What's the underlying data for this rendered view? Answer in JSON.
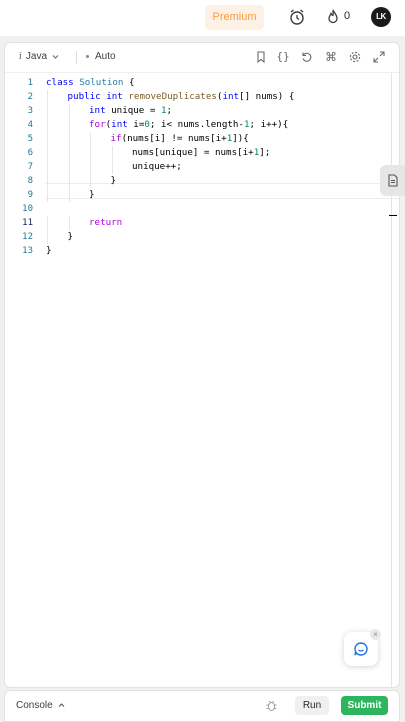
{
  "topbar": {
    "premium_label": "Premium",
    "streak_count": "0",
    "avatar_initials": "LK"
  },
  "toolbar": {
    "language": "Java",
    "language_icon": "i",
    "mode": "Auto"
  },
  "editor": {
    "active_line": 11,
    "lines": [
      {
        "n": "1",
        "tokens": [
          {
            "t": "class ",
            "c": "kw"
          },
          {
            "t": "Solution",
            "c": "ty"
          },
          {
            "t": " {",
            "c": "pl"
          }
        ],
        "indent": 0
      },
      {
        "n": "2",
        "tokens": [
          {
            "t": "public ",
            "c": "kw"
          },
          {
            "t": "int ",
            "c": "kw"
          },
          {
            "t": "removeDuplicates",
            "c": "fn"
          },
          {
            "t": "(",
            "c": "pl"
          },
          {
            "t": "int",
            "c": "kw"
          },
          {
            "t": "[] nums) ",
            "c": "pl"
          },
          {
            "t": "{",
            "c": "pl"
          }
        ],
        "indent": 1
      },
      {
        "n": "3",
        "tokens": [
          {
            "t": "int ",
            "c": "kw"
          },
          {
            "t": "unique = ",
            "c": "pl"
          },
          {
            "t": "1",
            "c": "num"
          },
          {
            "t": ";",
            "c": "pl"
          }
        ],
        "indent": 2
      },
      {
        "n": "4",
        "tokens": [
          {
            "t": "for",
            "c": "ctl"
          },
          {
            "t": "(",
            "c": "pl"
          },
          {
            "t": "int ",
            "c": "kw"
          },
          {
            "t": "i=",
            "c": "pl"
          },
          {
            "t": "0",
            "c": "num"
          },
          {
            "t": "; i< nums.length-",
            "c": "pl"
          },
          {
            "t": "1",
            "c": "num"
          },
          {
            "t": "; i++){",
            "c": "pl"
          }
        ],
        "indent": 2
      },
      {
        "n": "5",
        "tokens": [
          {
            "t": "if",
            "c": "ctl"
          },
          {
            "t": "(nums[i] != nums[i+",
            "c": "pl"
          },
          {
            "t": "1",
            "c": "num"
          },
          {
            "t": "]){",
            "c": "pl"
          }
        ],
        "indent": 3
      },
      {
        "n": "6",
        "tokens": [
          {
            "t": "nums[unique] = nums[i+",
            "c": "pl"
          },
          {
            "t": "1",
            "c": "num"
          },
          {
            "t": "];",
            "c": "pl"
          }
        ],
        "indent": 4
      },
      {
        "n": "7",
        "tokens": [
          {
            "t": "unique++;",
            "c": "pl"
          }
        ],
        "indent": 4
      },
      {
        "n": "8",
        "tokens": [
          {
            "t": "}",
            "c": "pl"
          }
        ],
        "indent": 3
      },
      {
        "n": "9",
        "tokens": [
          {
            "t": "}",
            "c": "pl"
          }
        ],
        "indent": 2
      },
      {
        "n": "10",
        "tokens": [],
        "indent": 0
      },
      {
        "n": "11",
        "tokens": [
          {
            "t": "return",
            "c": "ctl"
          }
        ],
        "indent": 2
      },
      {
        "n": "12",
        "tokens": [
          {
            "t": "}",
            "c": "pl"
          }
        ],
        "indent": 1
      },
      {
        "n": "13",
        "tokens": [
          {
            "t": "}",
            "c": "pl"
          }
        ],
        "indent": 0
      }
    ]
  },
  "bottom": {
    "console_label": "Console",
    "run_label": "Run",
    "submit_label": "Submit"
  },
  "colors": {
    "premium_text": "#f59e42",
    "submit_bg": "#2db55d",
    "keyword": "#0000ff",
    "function": "#795e26",
    "control": "#af00db"
  },
  "icons": [
    "alarm-clock-icon",
    "flame-icon",
    "bookmark-icon",
    "braces-icon",
    "reset-icon",
    "command-icon",
    "gear-icon",
    "expand-icon",
    "file-icon",
    "chat-icon",
    "bug-icon",
    "chevron-down-icon",
    "chevron-up-icon"
  ]
}
